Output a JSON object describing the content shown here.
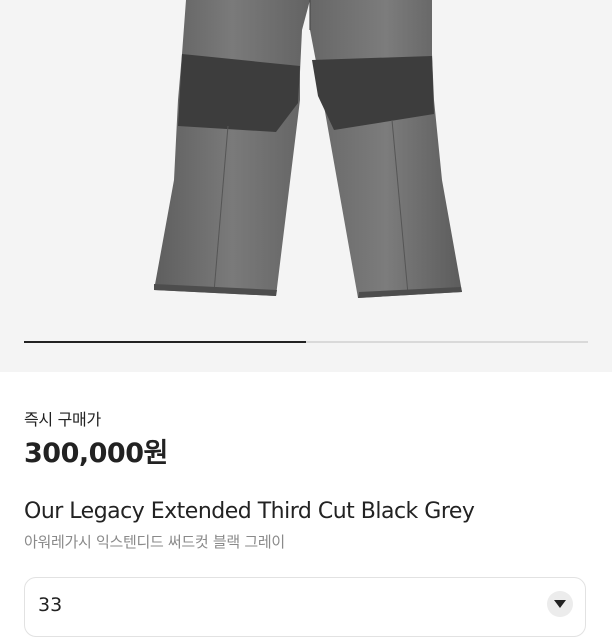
{
  "product": {
    "price_label": "즉시 구매가",
    "price": "300,000원",
    "name_en": "Our Legacy Extended Third Cut Black Grey",
    "name_ko": "아워레가시 익스텐디드 써드컷 블랙 그레이"
  },
  "carousel": {
    "progress_fraction": 0.5
  },
  "size_select": {
    "value": "33",
    "icon": "chevron-down-icon"
  },
  "colors": {
    "hero_background": "#f4f4f4",
    "denim": "#6f6f6f",
    "knee_panel": "#3d3d3d",
    "text_primary": "#222222",
    "text_secondary": "#8a8a8a"
  }
}
